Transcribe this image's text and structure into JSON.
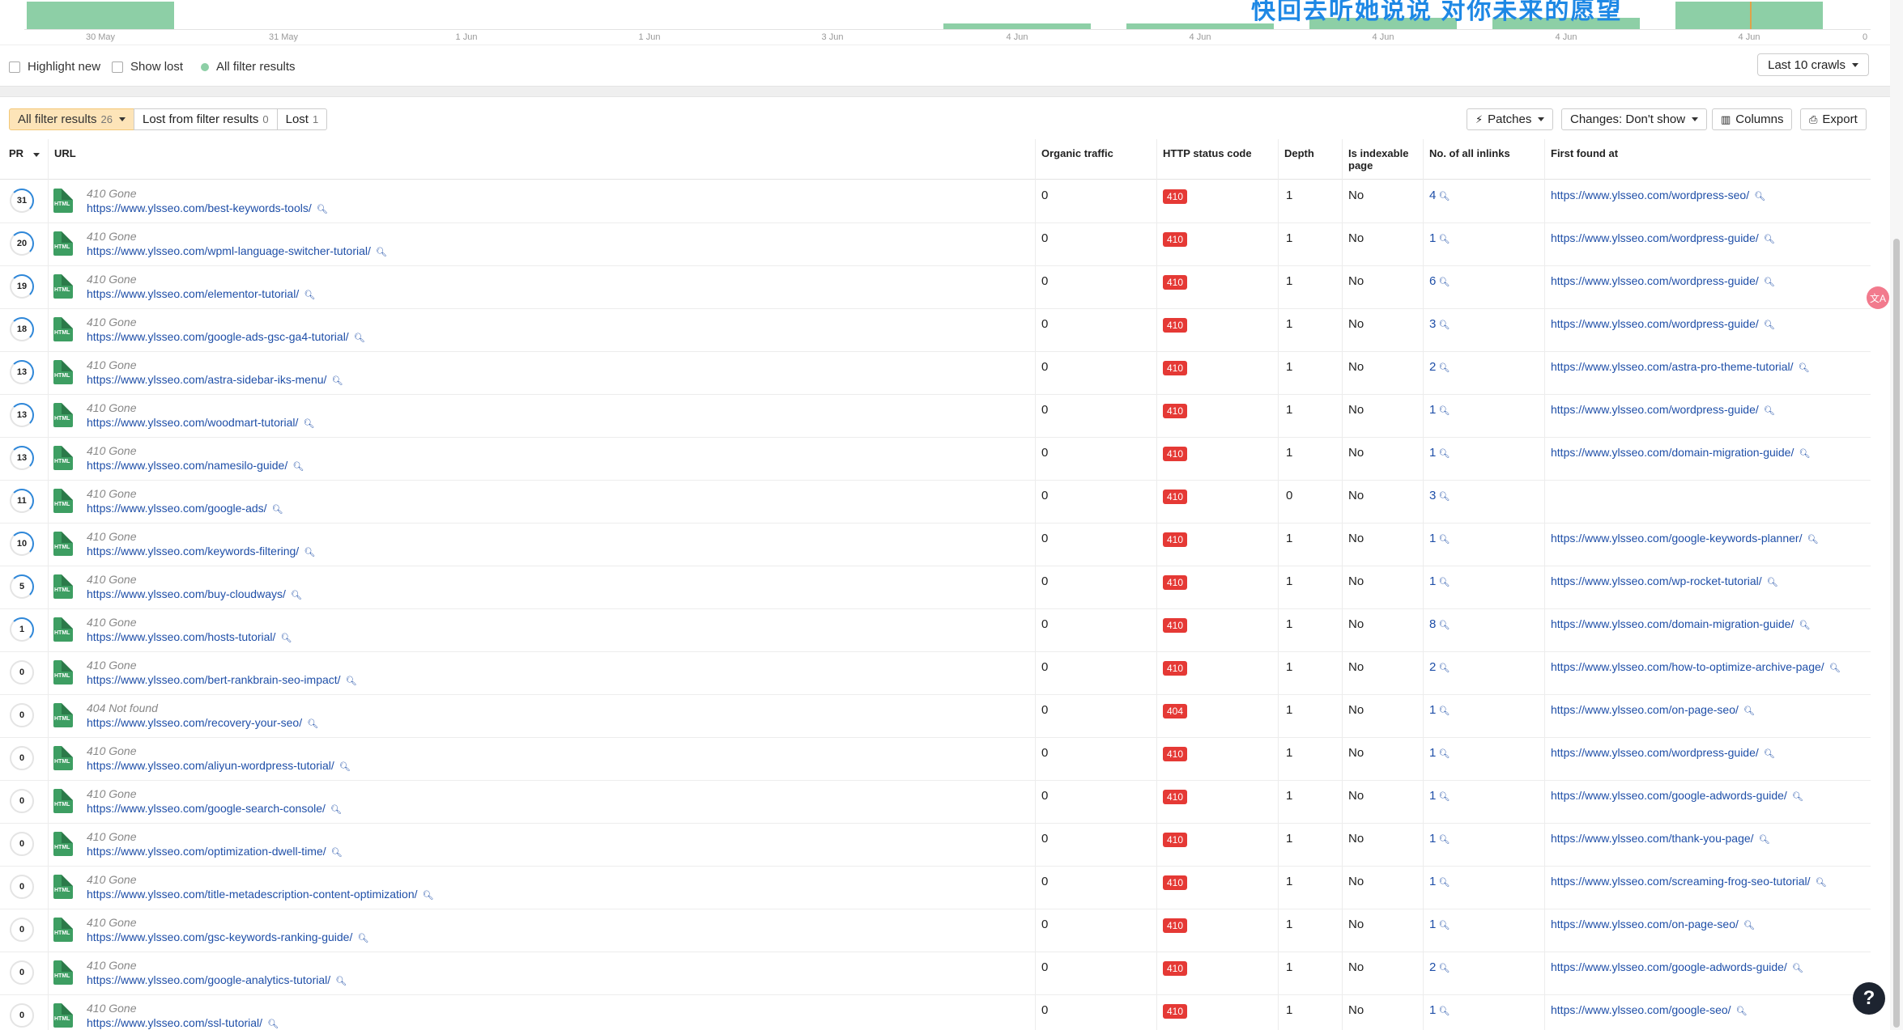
{
  "chart": {
    "overlay_text": "快回去听她说说  对你未来的愿望",
    "ticks": [
      "30 May",
      "31 May",
      "1 Jun",
      "1 Jun",
      "3 Jun",
      "4 Jun",
      "4 Jun",
      "4 Jun",
      "4 Jun",
      "4 Jun"
    ],
    "zero_label": "0",
    "bar_color": "#8dcfa6"
  },
  "legend": {
    "highlight_new": "Highlight new",
    "show_lost": "Show lost",
    "all_filter_results": "All filter results",
    "crawls_select": "Last 10 crawls"
  },
  "toolbar": {
    "tab_all": "All filter results",
    "tab_all_count": "26",
    "tab_lost_filter": "Lost from filter results",
    "tab_lost_filter_count": "0",
    "tab_lost": "Lost",
    "tab_lost_count": "1",
    "patches": "Patches",
    "changes": "Changes: Don't show",
    "columns": "Columns",
    "export": "Export"
  },
  "table": {
    "headers": {
      "pr": "PR",
      "url": "URL",
      "organic": "Organic traffic",
      "http": "HTTP status code",
      "depth": "Depth",
      "indexable": "Is indexable page",
      "inlinks": "No. of all inlinks",
      "first_found": "First found at"
    },
    "file_label": "HTML",
    "rows": [
      {
        "pr": "31",
        "status": "410 Gone",
        "url": "https://www.ylsseo.com/best-keywords-tools/",
        "organic": "0",
        "code": "410",
        "depth": "1",
        "indexable": "No",
        "inlinks": "4",
        "found": "https://www.ylsseo.com/wordpress-seo/"
      },
      {
        "pr": "20",
        "status": "410 Gone",
        "url": "https://www.ylsseo.com/wpml-language-switcher-tutorial/",
        "organic": "0",
        "code": "410",
        "depth": "1",
        "indexable": "No",
        "inlinks": "1",
        "found": "https://www.ylsseo.com/wordpress-guide/"
      },
      {
        "pr": "19",
        "status": "410 Gone",
        "url": "https://www.ylsseo.com/elementor-tutorial/",
        "organic": "0",
        "code": "410",
        "depth": "1",
        "indexable": "No",
        "inlinks": "6",
        "found": "https://www.ylsseo.com/wordpress-guide/"
      },
      {
        "pr": "18",
        "status": "410 Gone",
        "url": "https://www.ylsseo.com/google-ads-gsc-ga4-tutorial/",
        "organic": "0",
        "code": "410",
        "depth": "1",
        "indexable": "No",
        "inlinks": "3",
        "found": "https://www.ylsseo.com/wordpress-guide/"
      },
      {
        "pr": "13",
        "status": "410 Gone",
        "url": "https://www.ylsseo.com/astra-sidebar-iks-menu/",
        "organic": "0",
        "code": "410",
        "depth": "1",
        "indexable": "No",
        "inlinks": "2",
        "found": "https://www.ylsseo.com/astra-pro-theme-tutorial/"
      },
      {
        "pr": "13",
        "status": "410 Gone",
        "url": "https://www.ylsseo.com/woodmart-tutorial/",
        "organic": "0",
        "code": "410",
        "depth": "1",
        "indexable": "No",
        "inlinks": "1",
        "found": "https://www.ylsseo.com/wordpress-guide/"
      },
      {
        "pr": "13",
        "status": "410 Gone",
        "url": "https://www.ylsseo.com/namesilo-guide/",
        "organic": "0",
        "code": "410",
        "depth": "1",
        "indexable": "No",
        "inlinks": "1",
        "found": "https://www.ylsseo.com/domain-migration-guide/"
      },
      {
        "pr": "11",
        "status": "410 Gone",
        "url": "https://www.ylsseo.com/google-ads/",
        "organic": "0",
        "code": "410",
        "depth": "0",
        "indexable": "No",
        "inlinks": "3",
        "found": ""
      },
      {
        "pr": "10",
        "status": "410 Gone",
        "url": "https://www.ylsseo.com/keywords-filtering/",
        "organic": "0",
        "code": "410",
        "depth": "1",
        "indexable": "No",
        "inlinks": "1",
        "found": "https://www.ylsseo.com/google-keywords-planner/"
      },
      {
        "pr": "5",
        "status": "410 Gone",
        "url": "https://www.ylsseo.com/buy-cloudways/",
        "organic": "0",
        "code": "410",
        "depth": "1",
        "indexable": "No",
        "inlinks": "1",
        "found": "https://www.ylsseo.com/wp-rocket-tutorial/"
      },
      {
        "pr": "1",
        "status": "410 Gone",
        "url": "https://www.ylsseo.com/hosts-tutorial/",
        "organic": "0",
        "code": "410",
        "depth": "1",
        "indexable": "No",
        "inlinks": "8",
        "found": "https://www.ylsseo.com/domain-migration-guide/"
      },
      {
        "pr": "0",
        "status": "410 Gone",
        "url": "https://www.ylsseo.com/bert-rankbrain-seo-impact/",
        "organic": "0",
        "code": "410",
        "depth": "1",
        "indexable": "No",
        "inlinks": "2",
        "found": "https://www.ylsseo.com/how-to-optimize-archive-page/"
      },
      {
        "pr": "0",
        "status": "404 Not found",
        "url": "https://www.ylsseo.com/recovery-your-seo/",
        "organic": "0",
        "code": "404",
        "depth": "1",
        "indexable": "No",
        "inlinks": "1",
        "found": "https://www.ylsseo.com/on-page-seo/"
      },
      {
        "pr": "0",
        "status": "410 Gone",
        "url": "https://www.ylsseo.com/aliyun-wordpress-tutorial/",
        "organic": "0",
        "code": "410",
        "depth": "1",
        "indexable": "No",
        "inlinks": "1",
        "found": "https://www.ylsseo.com/wordpress-guide/"
      },
      {
        "pr": "0",
        "status": "410 Gone",
        "url": "https://www.ylsseo.com/google-search-console/",
        "organic": "0",
        "code": "410",
        "depth": "1",
        "indexable": "No",
        "inlinks": "1",
        "found": "https://www.ylsseo.com/google-adwords-guide/"
      },
      {
        "pr": "0",
        "status": "410 Gone",
        "url": "https://www.ylsseo.com/optimization-dwell-time/",
        "organic": "0",
        "code": "410",
        "depth": "1",
        "indexable": "No",
        "inlinks": "1",
        "found": "https://www.ylsseo.com/thank-you-page/"
      },
      {
        "pr": "0",
        "status": "410 Gone",
        "url": "https://www.ylsseo.com/title-metadescription-content-optimization/",
        "organic": "0",
        "code": "410",
        "depth": "1",
        "indexable": "No",
        "inlinks": "1",
        "found": "https://www.ylsseo.com/screaming-frog-seo-tutorial/"
      },
      {
        "pr": "0",
        "status": "410 Gone",
        "url": "https://www.ylsseo.com/gsc-keywords-ranking-guide/",
        "organic": "0",
        "code": "410",
        "depth": "1",
        "indexable": "No",
        "inlinks": "1",
        "found": "https://www.ylsseo.com/on-page-seo/"
      },
      {
        "pr": "0",
        "status": "410 Gone",
        "url": "https://www.ylsseo.com/google-analytics-tutorial/",
        "organic": "0",
        "code": "410",
        "depth": "1",
        "indexable": "No",
        "inlinks": "2",
        "found": "https://www.ylsseo.com/google-adwords-guide/"
      },
      {
        "pr": "0",
        "status": "410 Gone",
        "url": "https://www.ylsseo.com/ssl-tutorial/",
        "organic": "0",
        "code": "410",
        "depth": "1",
        "indexable": "No",
        "inlinks": "1",
        "found": "https://www.ylsseo.com/google-seo/"
      }
    ]
  },
  "fab": {
    "translate_glyph": "文A",
    "help_glyph": "?"
  }
}
